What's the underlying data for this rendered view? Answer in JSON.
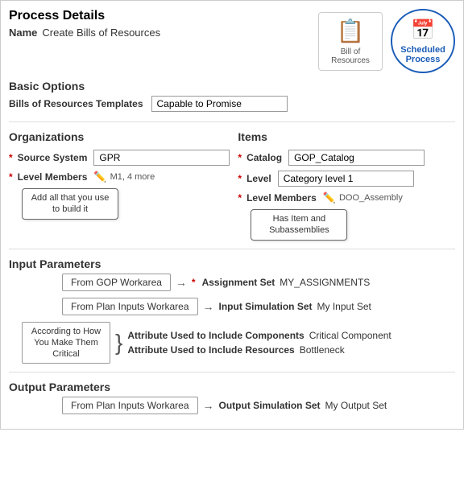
{
  "page": {
    "title": "Process Details",
    "name_label": "Name",
    "name_value": "Create Bills of Resources"
  },
  "icons": {
    "bill_label": "Bill of Resources",
    "scheduled_label": "Scheduled Process"
  },
  "basic_options": {
    "title": "Basic Options",
    "templates_label": "Bills of Resources Templates",
    "templates_value": "Capable to Promise"
  },
  "organizations": {
    "title": "Organizations",
    "source_system_label": "Source System",
    "source_system_value": "GPR",
    "level_members_label": "Level Members",
    "level_members_tooltip": "M1, 4 more",
    "level_members_hint": "Add all that you use to build it"
  },
  "items": {
    "title": "Items",
    "catalog_label": "Catalog",
    "catalog_value": "GOP_Catalog",
    "level_label": "Level",
    "level_value": "Category level 1",
    "level_members_label": "Level Members",
    "level_members_value": "DOO_Assembly",
    "level_members_hint": "Has Item and Subassemblies"
  },
  "input_parameters": {
    "title": "Input Parameters",
    "workarea1_label": "From GOP Workarea",
    "assignment_set_label": "Assignment Set",
    "assignment_set_value": "MY_ASSIGNMENTS",
    "workarea2_label": "From Plan Inputs Workarea",
    "input_simulation_label": "Input Simulation Set",
    "input_simulation_value": "My Input Set",
    "brace_label": "According to How You Make Them Critical",
    "attribute_include_components_label": "Attribute Used to Include Components",
    "attribute_include_components_value": "Critical Component",
    "attribute_include_resources_label": "Attribute Used to Include Resources",
    "attribute_include_resources_value": "Bottleneck"
  },
  "output_parameters": {
    "title": "Output Parameters",
    "workarea_label": "From Plan Inputs Workarea",
    "output_simulation_label": "Output Simulation Set",
    "output_simulation_value": "My Output Set"
  }
}
